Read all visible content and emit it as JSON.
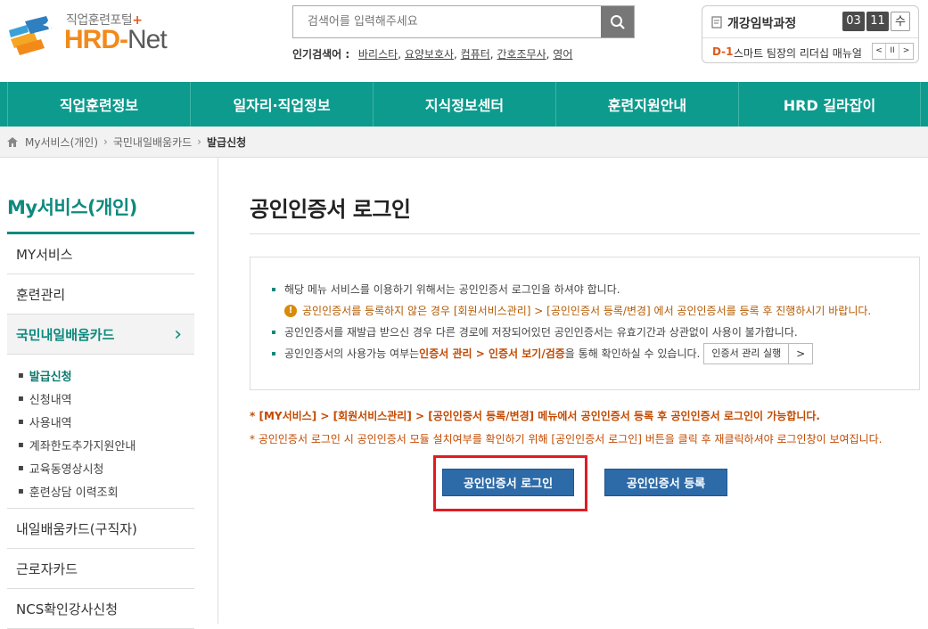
{
  "header": {
    "logo_sub": "직업훈련포털",
    "logo_plus": "+",
    "logo_main": "HRD-",
    "logo_net": "Net",
    "search_placeholder": "검색어를 입력해주세요",
    "popular_label": "인기검색어 :",
    "popular_keywords": [
      "바리스타",
      "요양보호사",
      "컴퓨터",
      "간호조무사",
      "영어"
    ],
    "notice": {
      "title": "개강임박과정",
      "month": "03",
      "day": "11",
      "dow": "수",
      "dday": "D-1",
      "text": "스마트 팀장의 리더십 매뉴얼",
      "ctrl_prev": "<",
      "ctrl_pause": "II",
      "ctrl_next": ">"
    }
  },
  "nav": [
    "직업훈련정보",
    "일자리·직업정보",
    "지식정보센터",
    "훈련지원안내",
    "HRD 길라잡이"
  ],
  "breadcrumb": [
    "My서비스(개인)",
    "국민내일배움카드",
    "발급신청"
  ],
  "sidebar": {
    "title": "My서비스(개인)",
    "items_top": [
      "MY서비스",
      "훈련관리"
    ],
    "active_item": "국민내일배움카드",
    "active_arrow": "›",
    "sub_items": [
      "발급신청",
      "신청내역",
      "사용내역",
      "계좌한도추가지원안내",
      "교육동영상시청",
      "훈련상담 이력조회"
    ],
    "items_bottom": [
      "내일배움카드(구직자)",
      "근로자카드",
      "NCS확인강사신청"
    ]
  },
  "main": {
    "title": "공인인증서 로그인",
    "info1": "해당 메뉴 서비스를 이용하기 위해서는 공인인증서 로그인을 하셔야 합니다.",
    "warn_icon": "!",
    "warn": "공인인증서를 등록하지 않은 경우 [회원서비스관리] > [공인인증서 등록/변경] 에서 공인인증서를 등록 후 진행하시기 바랍니다.",
    "info2": "공인인증서를 재발급 받으신 경우 다른 경로에 저장되어있던 공인인증서는 유효기간과 상관없이 사용이 불가합니다.",
    "info3_pre": "공인인증서의 사용가능 여부는 ",
    "info3_hl": "인증서 관리 > 인증서 보기/검증",
    "info3_post": "을 통해 확인하실 수 있습니다.",
    "mini_btn": "인증서 관리 실행",
    "mini_btn_arrow": ">",
    "note1": "* [MY서비스] > [회원서비스관리] > [공인인증서 등록/변경] 메뉴에서 공인인증서 등록 후 공인인증서 로그인이 가능합니다.",
    "note2": "* 공인인증서 로그인 시 공인인증서 모듈 설치여부를 확인하기 위해 [공인인증서 로그인] 버튼을 클릭 후 재클릭하셔야 로그인창이 보여집니다.",
    "btn_login": "공인인증서 로그인",
    "btn_register": "공인인증서 등록"
  },
  "colors": {
    "nav_bg": "#0d9b8d",
    "accent": "#0d8a7e",
    "button_blue": "#2d6aa8",
    "highlight_frame": "#e11b22",
    "note_text": "#c34a00"
  }
}
